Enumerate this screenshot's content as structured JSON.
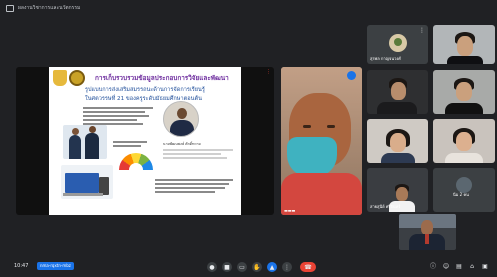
{
  "meeting": {
    "title": "ผลงานวิชาการและนวัตกรรม",
    "time": "10:47",
    "code": "nma-rqxtn-mbz"
  },
  "presentation": {
    "title": "การเก็บรวบรวมข้อมูลประกอบการวิจัยและพัฒนา",
    "subtitle": "รูปแบบการส่งเสริมสมรรถนะด้านการจัดการเรียนรู้",
    "subtitle2": "ในศตวรรษที่ 21 ของครูระดับมัธยมศึกษาตอนต้น",
    "presenter_name": "นายพัฒนพงษ์ ศักดิ์ทวาย"
  },
  "participants": [
    {
      "name": "สุรพล กาญจนวงศ์"
    },
    {
      "name": "สายสุนีย์ ศรีจันทร์"
    },
    {
      "name": "ชัช ภูอ่อน"
    },
    {
      "name": "นิ่ม 2 คน"
    }
  ],
  "icons": {
    "more": "more-vert-icon",
    "mic": "mic-icon",
    "cam": "camera-icon",
    "cc": "captions-icon",
    "hand": "raise-hand-icon",
    "present": "present-icon",
    "more2": "more-options-icon",
    "hangup": "call-end-icon",
    "info": "info-icon",
    "people": "people-icon",
    "chat": "chat-icon",
    "activities": "activities-icon"
  },
  "colors": {
    "bg": "#202124",
    "tile": "#3c4043",
    "accent": "#1a73e8",
    "end": "#ea4335"
  }
}
